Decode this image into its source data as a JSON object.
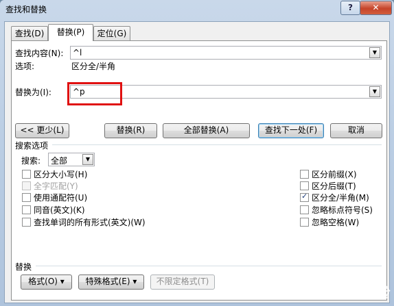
{
  "window": {
    "title": "查找和替换",
    "help_label": "?",
    "close_label": "✕"
  },
  "tabs": [
    {
      "label": "查找(D)"
    },
    {
      "label": "替换(P)"
    },
    {
      "label": "定位(G)"
    }
  ],
  "find": {
    "label": "查找内容(N):",
    "value": "^l",
    "options_label": "选项:",
    "options_value": "区分全/半角"
  },
  "replace": {
    "label": "替换为(I):",
    "value": "^p"
  },
  "buttons": {
    "less": "<< 更少(L)",
    "replace": "替换(R)",
    "replace_all": "全部替换(A)",
    "find_next": "查找下一处(F)",
    "cancel": "取消"
  },
  "search_options": {
    "heading": "搜索选项",
    "search_label": "搜索:",
    "search_value": "全部",
    "left": [
      {
        "label": "区分大小写(H)",
        "checked": false,
        "disabled": false
      },
      {
        "label": "全字匹配(Y)",
        "checked": false,
        "disabled": true
      },
      {
        "label": "使用通配符(U)",
        "checked": false,
        "disabled": false
      },
      {
        "label": "同音(英文)(K)",
        "checked": false,
        "disabled": false
      },
      {
        "label": "查找单词的所有形式(英文)(W)",
        "checked": false,
        "disabled": false
      }
    ],
    "right": [
      {
        "label": "区分前缀(X)",
        "checked": false,
        "disabled": false
      },
      {
        "label": "区分后缀(T)",
        "checked": false,
        "disabled": false
      },
      {
        "label": "区分全/半角(M)",
        "checked": true,
        "disabled": false
      },
      {
        "label": "忽略标点符号(S)",
        "checked": false,
        "disabled": false
      },
      {
        "label": "忽略空格(W)",
        "checked": false,
        "disabled": false
      }
    ]
  },
  "replace_section": {
    "heading": "替换",
    "format": "格式(O) ▾",
    "special": "特殊格式(E) ▾",
    "no_format": "不限定格式(T)"
  },
  "watermark": "Bai 经验"
}
